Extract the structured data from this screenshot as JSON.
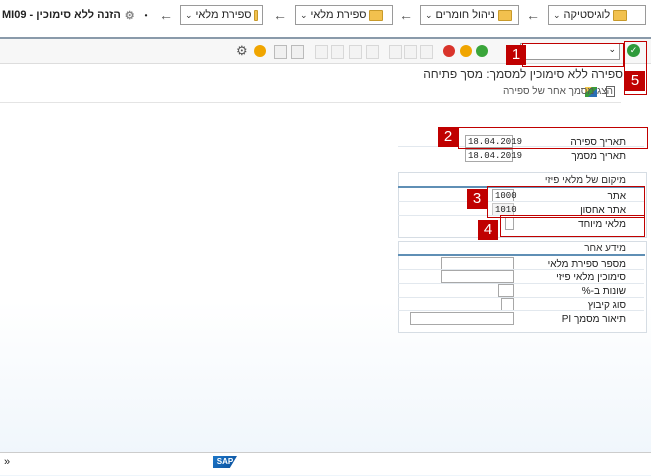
{
  "breadcrumb": {
    "items": [
      {
        "label": "לוגיסטיקה"
      },
      {
        "label": "ניהול חומרים"
      },
      {
        "label": "ספירת מלאי"
      },
      {
        "label": "ספירת מלאי"
      }
    ],
    "current": "MI09 - הזנה ללא סימוכין"
  },
  "header": {
    "title": "ספירה ללא סימוכין למסמך: מסך פתיחה",
    "appbar_label": "הצג מסמך אחר של ספירה"
  },
  "form": {
    "count_date_label": "תאריך ספירה",
    "count_date_value": "18.04.2019",
    "doc_date_label": "תאריך מסמך",
    "doc_date_value": "18.04.2019",
    "location_group_title": "מיקום של מלאי פיזי",
    "plant_label": "אתר",
    "plant_value": "1000",
    "storage_label": "אתר אחסון",
    "storage_value": "1010",
    "special_stock_label": "מלאי מיוחד",
    "other_group_title": "מידע אחר",
    "phys_inv_no_label": "מספר ספירת מלאי",
    "phys_inv_ref_label": "סימוכין מלאי פיזי",
    "diff_pct_label": "שונות ב-%",
    "grouping_label": "סוג קיבוץ",
    "pi_desc_label": "תיאור מסמך PI"
  },
  "callouts": [
    "1",
    "2",
    "3",
    "4",
    "5"
  ],
  "footer": {
    "scroll_marker": "»",
    "logo": "SAP"
  },
  "colors": {
    "callout": "#c00000",
    "folder": "#f2c14e",
    "accent": "#5f8fb5"
  }
}
